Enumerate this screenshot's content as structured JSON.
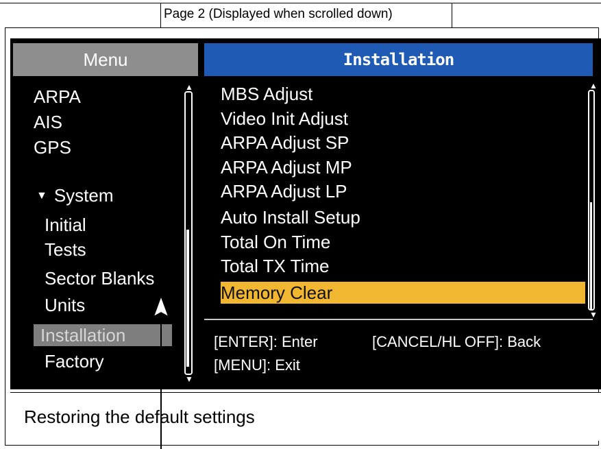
{
  "caption": "Page 2 (Displayed when scrolled down)",
  "menu": {
    "title": "Menu",
    "items": [
      "ARPA",
      "AIS",
      "GPS"
    ],
    "section": "System",
    "subitems": [
      "Initial",
      "Tests",
      "Sector Blanks",
      "Units",
      "Installation",
      "Factory"
    ],
    "selected": "Installation"
  },
  "installation": {
    "title": "Installation",
    "items": [
      "MBS Adjust",
      "Video Init Adjust",
      "ARPA Adjust SP",
      "ARPA Adjust MP",
      "ARPA Adjust LP",
      "Auto Install Setup",
      "Total On Time",
      "Total TX Time",
      "Memory Clear"
    ],
    "highlighted": "Memory Clear",
    "help": {
      "enter": "[ENTER]: Enter",
      "back": "[CANCEL/HL OFF]: Back",
      "exit": "[MENU]: Exit"
    }
  },
  "status": {
    "text": "Restoring the default settings"
  },
  "colors": {
    "title_blue": "#1f5bb4",
    "highlight_yellow": "#f1b731",
    "menu_gray": "#8e8e8e"
  }
}
